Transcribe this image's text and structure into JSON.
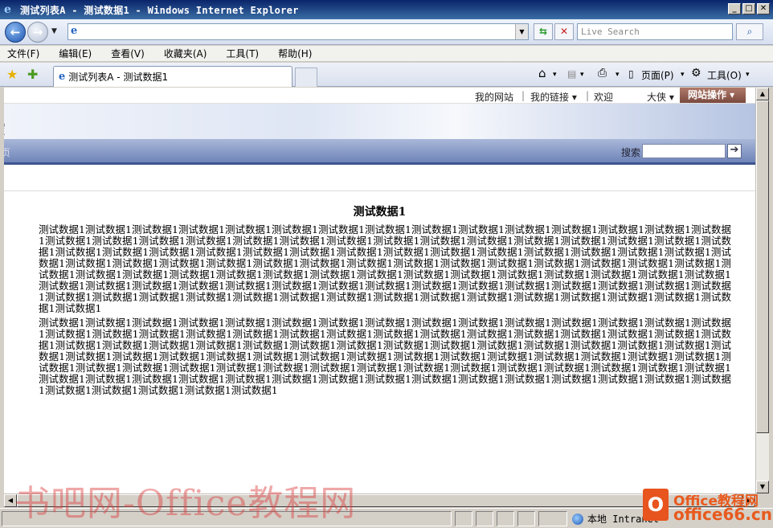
{
  "window": {
    "title": "测试列表A - 测试数据1 - Windows Internet Explorer",
    "minimize": "_",
    "maximize": "□",
    "close": "✕"
  },
  "address": {
    "value": "",
    "refresh_glyph": "⇆",
    "stop_glyph": "✕",
    "search_placeholder": "Live Search",
    "search_go_glyph": "⌕",
    "dropdown_glyph": "▼",
    "back_glyph": "←",
    "forward_glyph": "→"
  },
  "menu": [
    "文件(F)",
    "编辑(E)",
    "查看(V)",
    "收藏夹(A)",
    "工具(T)",
    "帮助(H)"
  ],
  "tabs": {
    "active": "测试列表A - 测试数据1"
  },
  "commands": {
    "page": "页面(P)",
    "tools": "工具(O)",
    "home_glyph": "⌂",
    "feeds_glyph": "▤",
    "print_glyph": "⎙",
    "page_glyph": "▯",
    "tools_glyph": "⚙",
    "drop_glyph": "▾"
  },
  "site": {
    "nav_links": {
      "my_site": "我的网站",
      "my_links": "我的链接 ▾",
      "welcome": "欢迎",
      "user": "大侠 ▾"
    },
    "site_actions": "网站操作 ▾",
    "title_fragment": "空",
    "nav_fragment": "页",
    "search_label": "搜索",
    "search_go": "➔"
  },
  "document": {
    "title": "测试数据1",
    "para1": "测试数据1测试数据1测试数据1测试数据1测试数据1测试数据1测试数据1测试数据1测试数据1测试数据1测试数据1测试数据1测试数据1测试数据1测试数据1测试数据1测试数据1测试数据1测试数据1测试数据1测试数据1测试数据1测试数据1测试数据1测试数据1测试数据1测试数据1测试数据1测试数据1测试数据1测试数据1测试数据1测试数据1测试数据1测试数据1测试数据1测试数据1测试数据1测试数据1测试数据1测试数据1测试数据1测试数据1测试数据1测试数据1测试数据1测试数据1测试数据1测试数据1测试数据1测试数据1测试数据1测试数据1测试数据1测试数据1测试数据1测试数据1测试数据1测试数据1测试数据1测试数据1测试数据1测试数据1测试数据1测试数据1测试数据1测试数据1测试数据1测试数据1测试数据1测试数据1测试数据1测试数据1测试数据1测试数据1测试数据1测试数据1测试数据1测试数据1测试数据1测试数据1测试数据1测试数据1测试数据1测试数据1测试数据1测试数据1测试数据1测试数据1测试数据1测试数据1测试数据1测试数据1测试数据1测试数据1测试数据1测试数据1测试数据1测试数据1测试数据1测试数据1测试数据1测试数据1测试数据1测试数据1",
    "para2": "测试数据1测试数据1测试数据1测试数据1测试数据1测试数据1测试数据1测试数据1测试数据1测试数据1测试数据1测试数据1测试数据1测试数据1测试数据1测试数据1测试数据1测试数据1测试数据1测试数据1测试数据1测试数据1测试数据1测试数据1测试数据1测试数据1测试数据1测试数据1测试数据1测试数据1测试数据1测试数据1测试数据1测试数据1测试数据1测试数据1测试数据1测试数据1测试数据1测试数据1测试数据1测试数据1测试数据1测试数据1测试数据1测试数据1测试数据1测试数据1测试数据1测试数据1测试数据1测试数据1测试数据1测试数据1测试数据1测试数据1测试数据1测试数据1测试数据1测试数据1测试数据1测试数据1测试数据1测试数据1测试数据1测试数据1测试数据1测试数据1测试数据1测试数据1测试数据1测试数据1测试数据1测试数据1测试数据1测试数据1测试数据1测试数据1测试数据1测试数据1测试数据1测试数据1测试数据1测试数据1测试数据1测试数据1测试数据1测试数据1测试数据1测试数据1测试数据1测试数据1测试数据1测试数据1"
  },
  "status": {
    "zone": "本地 Intranet"
  },
  "watermarks": {
    "left": "书吧网-Office教程网",
    "logo": "O",
    "right_line1": "Office教程网",
    "right_line2": "office66.cn"
  }
}
